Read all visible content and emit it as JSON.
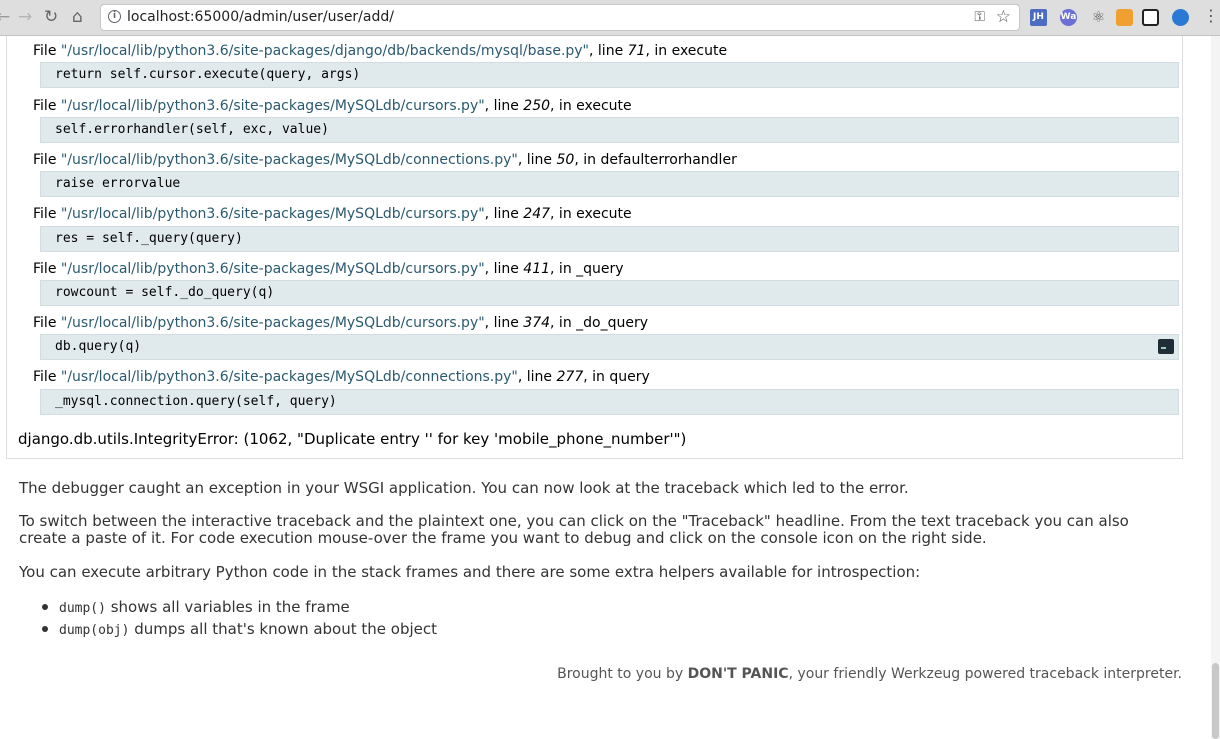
{
  "browser": {
    "url": "localhost:65000/admin/user/user/add/",
    "extensions": [
      "JH",
      "Wa"
    ]
  },
  "traceback": {
    "frames": [
      {
        "prefix": "File ",
        "file": "\"/usr/local/lib/python3.6/site-packages/django/db/backends/mysql/base.py\"",
        "mid": ", line ",
        "line": "71",
        "suffix": ", in execute",
        "code": "return self.cursor.execute(query, args)"
      },
      {
        "prefix": "File ",
        "file": "\"/usr/local/lib/python3.6/site-packages/MySQLdb/cursors.py\"",
        "mid": ", line ",
        "line": "250",
        "suffix": ", in execute",
        "code": "self.errorhandler(self, exc, value)"
      },
      {
        "prefix": "File ",
        "file": "\"/usr/local/lib/python3.6/site-packages/MySQLdb/connections.py\"",
        "mid": ", line ",
        "line": "50",
        "suffix": ", in defaulterrorhandler",
        "code": "raise errorvalue"
      },
      {
        "prefix": "File ",
        "file": "\"/usr/local/lib/python3.6/site-packages/MySQLdb/cursors.py\"",
        "mid": ", line ",
        "line": "247",
        "suffix": ", in execute",
        "code": "res = self._query(query)"
      },
      {
        "prefix": "File ",
        "file": "\"/usr/local/lib/python3.6/site-packages/MySQLdb/cursors.py\"",
        "mid": ", line ",
        "line": "411",
        "suffix": ", in _query",
        "code": "rowcount = self._do_query(q)"
      },
      {
        "prefix": "File ",
        "file": "\"/usr/local/lib/python3.6/site-packages/MySQLdb/cursors.py\"",
        "mid": ", line ",
        "line": "374",
        "suffix": ", in _do_query",
        "code": "db.query(q)"
      },
      {
        "prefix": "File ",
        "file": "\"/usr/local/lib/python3.6/site-packages/MySQLdb/connections.py\"",
        "mid": ", line ",
        "line": "277",
        "suffix": ", in query",
        "code": "_mysql.connection.query(self, query)"
      }
    ],
    "exception": "django.db.utils.IntegrityError: (1062, \"Duplicate entry '' for key 'mobile_phone_number'\")"
  },
  "explanation": {
    "p1": "The debugger caught an exception in your WSGI application. You can now look at the traceback which led to the error.",
    "p2": "To switch between the interactive traceback and the plaintext one, you can click on the \"Traceback\" headline. From the text traceback you can also create a paste of it. For code execution mouse-over the frame you want to debug and click on the console icon on the right side.",
    "p3": "You can execute arbitrary Python code in the stack frames and there are some extra helpers available for introspection:",
    "helpers": [
      {
        "code": "dump()",
        "text": " shows all variables in the frame"
      },
      {
        "code": "dump(obj)",
        "text": " dumps all that's known about the object"
      }
    ]
  },
  "footer": {
    "prefix": "Brought to you by ",
    "brand": "DON'T PANIC",
    "suffix": ", your friendly Werkzeug powered traceback interpreter."
  }
}
